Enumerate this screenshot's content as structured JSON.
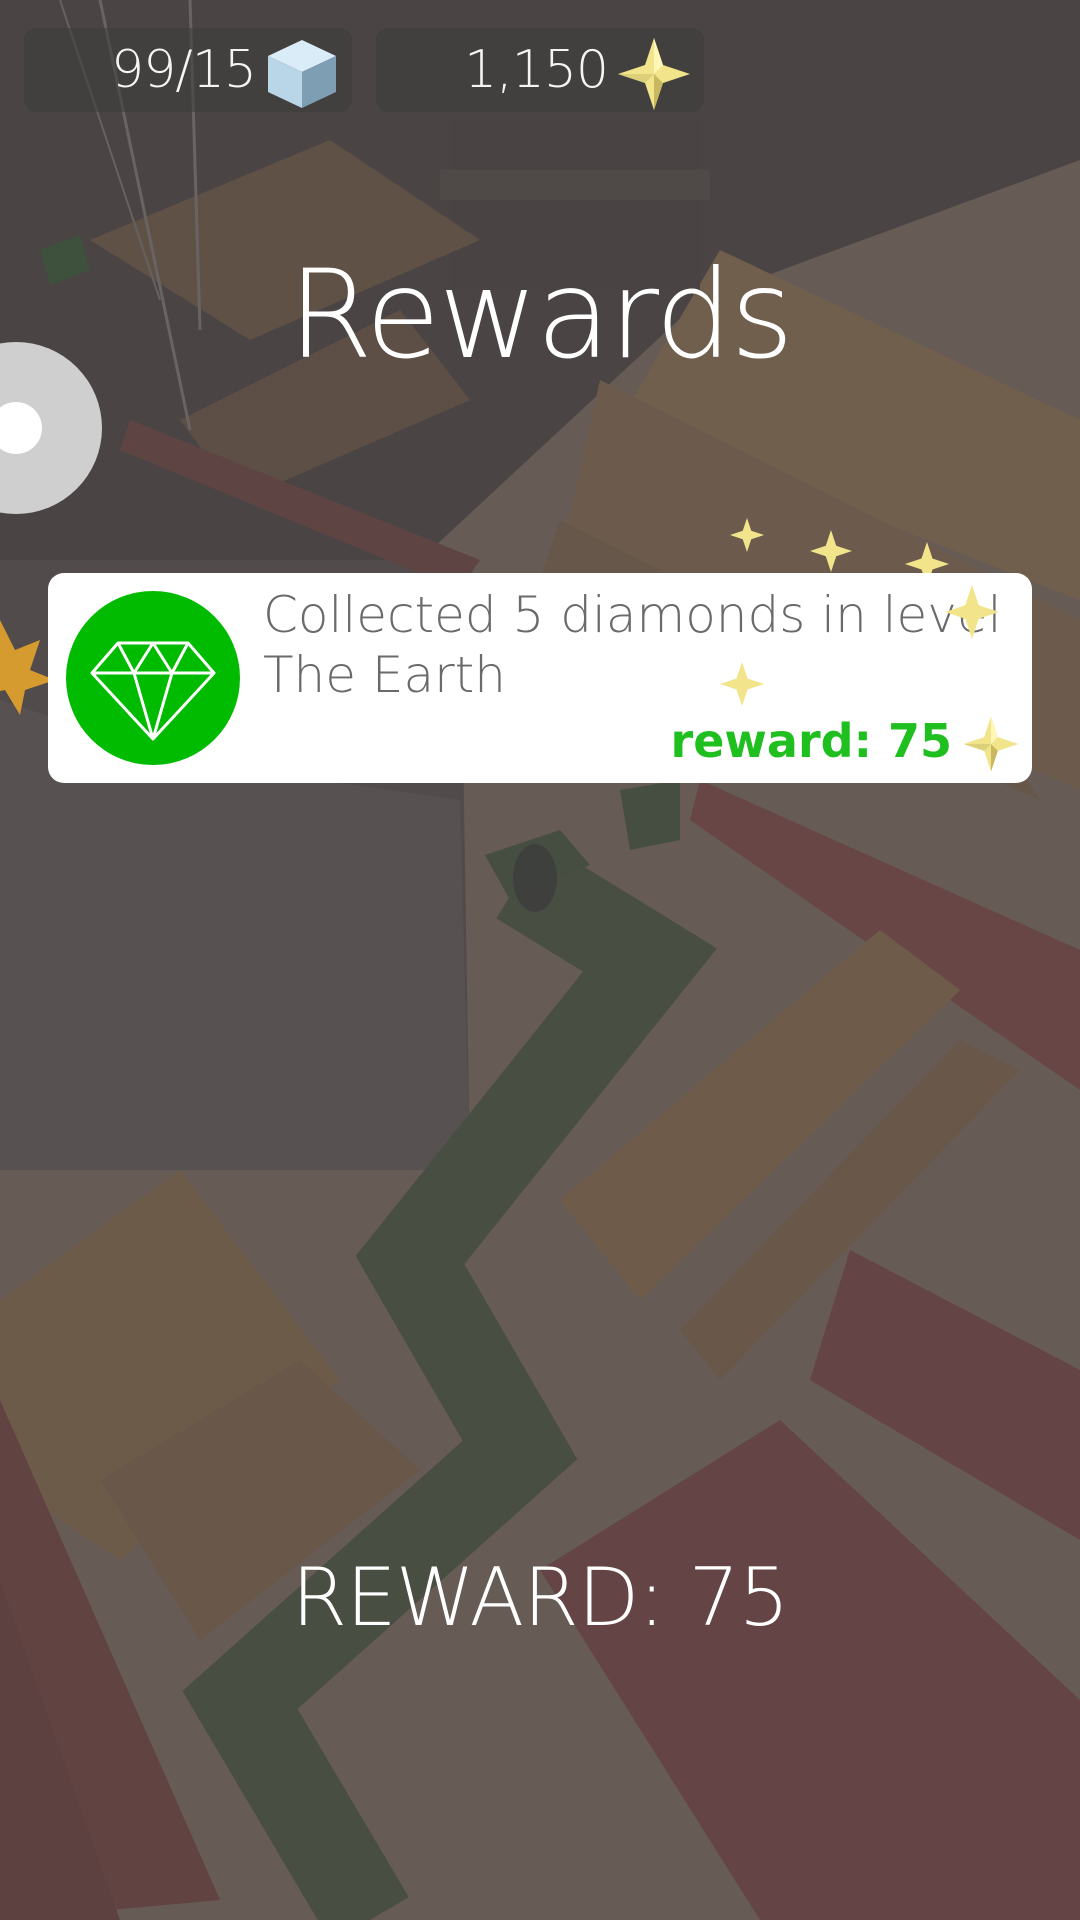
{
  "hud": {
    "cubes": "99/15",
    "cubes_icon": "cube-icon",
    "gems": "1,150",
    "gems_icon": "star-gem-icon"
  },
  "title": "Rewards",
  "achievement": {
    "icon": "diamond-icon",
    "line1": "Collected 5 diamonds in level",
    "line2": "The Earth",
    "reward_label": "reward: 75",
    "reward_icon": "star-gem-icon"
  },
  "total_reward": "REWARD: 75",
  "colors": {
    "badge_green": "#00bb00",
    "reward_green": "#1fbf1f",
    "star_yellow": "#f2e48a",
    "cube_blue": "#a9cde0"
  }
}
